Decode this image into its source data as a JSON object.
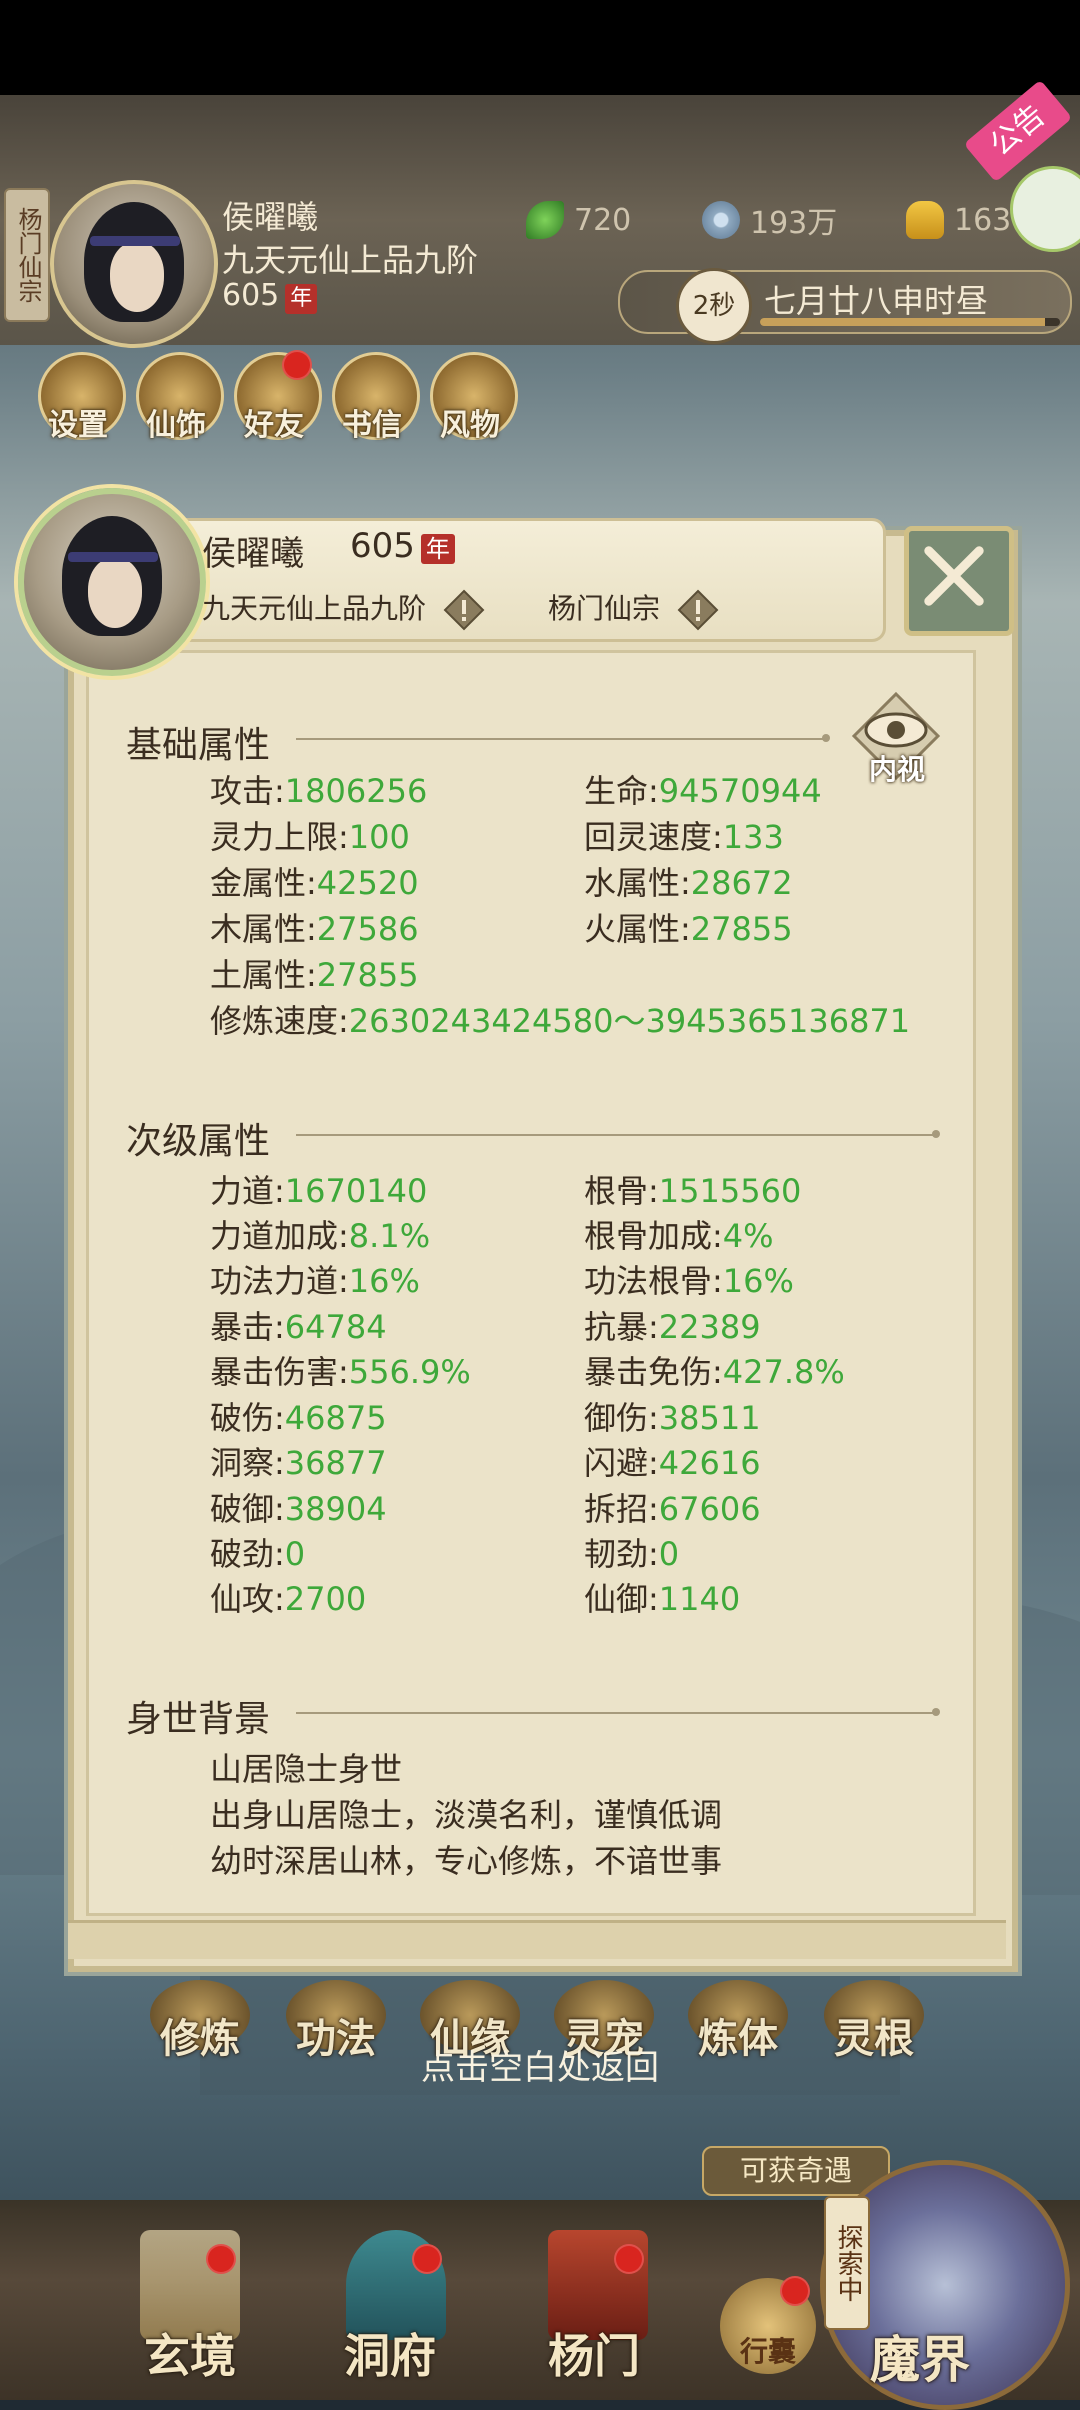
{
  "top_profile": {
    "sect_label": "杨门仙宗",
    "name": "侯曜曦",
    "rank": "九天元仙上品九阶",
    "age": "605",
    "age_unit": "年"
  },
  "currencies": [
    {
      "icon": "leaf-icon",
      "value": "720"
    },
    {
      "icon": "coin-icon",
      "value": "193万"
    },
    {
      "icon": "ingot-icon",
      "value": "163"
    }
  ],
  "notice": {
    "label": "公告"
  },
  "time_bar": {
    "seconds": "2秒",
    "date_text": "七月廿八申时昼",
    "progress": 0.95
  },
  "menu": [
    {
      "label": "设置",
      "icon": "settings-icon",
      "red_dot": false
    },
    {
      "label": "仙饰",
      "icon": "costume-icon",
      "red_dot": false
    },
    {
      "label": "好友",
      "icon": "friends-icon",
      "red_dot": true
    },
    {
      "label": "书信",
      "icon": "letter-icon",
      "red_dot": false
    },
    {
      "label": "风物",
      "icon": "scenery-icon",
      "red_dot": false
    }
  ],
  "panel": {
    "name": "侯曜曦",
    "age": "605",
    "age_unit": "年",
    "rank": "九天元仙上品九阶",
    "sect": "杨门仙宗",
    "inner_view_label": "内视",
    "basic_title": "基础属性",
    "basic_stats": [
      {
        "label": "攻击:",
        "value": "1806256"
      },
      {
        "label": "生命:",
        "value": "94570944"
      },
      {
        "label": "灵力上限:",
        "value": "100"
      },
      {
        "label": "回灵速度:",
        "value": "133"
      },
      {
        "label": "金属性:",
        "value": "42520"
      },
      {
        "label": "水属性:",
        "value": "28672"
      },
      {
        "label": "木属性:",
        "value": "27586"
      },
      {
        "label": "火属性:",
        "value": "27855"
      },
      {
        "label": "土属性:",
        "value": "27855"
      }
    ],
    "cultivation_speed": {
      "label": "修炼速度:",
      "value": "2630243424580～3945365136871"
    },
    "secondary_title": "次级属性",
    "secondary_stats": [
      {
        "label": "力道:",
        "value": "1670140"
      },
      {
        "label": "根骨:",
        "value": "1515560"
      },
      {
        "label": "力道加成:",
        "value": "8.1%"
      },
      {
        "label": "根骨加成:",
        "value": "4%"
      },
      {
        "label": "功法力道:",
        "value": "16%"
      },
      {
        "label": "功法根骨:",
        "value": "16%"
      },
      {
        "label": "暴击:",
        "value": "64784"
      },
      {
        "label": "抗暴:",
        "value": "22389"
      },
      {
        "label": "暴击伤害:",
        "value": "556.9%"
      },
      {
        "label": "暴击免伤:",
        "value": "427.8%"
      },
      {
        "label": "破伤:",
        "value": "46875"
      },
      {
        "label": "御伤:",
        "value": "38511"
      },
      {
        "label": "洞察:",
        "value": "36877"
      },
      {
        "label": "闪避:",
        "value": "42616"
      },
      {
        "label": "破御:",
        "value": "38904"
      },
      {
        "label": "拆招:",
        "value": "67606"
      },
      {
        "label": "破劲:",
        "value": "0"
      },
      {
        "label": "韧劲:",
        "value": "0"
      },
      {
        "label": "仙攻:",
        "value": "2700"
      },
      {
        "label": "仙御:",
        "value": "1140"
      }
    ],
    "background_title": "身世背景",
    "background_lines": [
      "山居隐士身世",
      "出身山居隐士，淡漠名利，谨慎低调",
      "幼时深居山林，专心修炼，不谙世事"
    ]
  },
  "bottom_menu": [
    "修炼",
    "功法",
    "仙缘",
    "灵宠",
    "炼体",
    "灵根"
  ],
  "back_hint": "点击空白处返回",
  "chance_button": "可获奇遇",
  "nav": [
    {
      "label": "玄境",
      "red_dot": true
    },
    {
      "label": "洞府",
      "red_dot": true
    },
    {
      "label": "杨门",
      "red_dot": true
    }
  ],
  "bag_label": "行囊",
  "exploring_label": "探索中",
  "mojie_label": "魔界",
  "colors": {
    "value_green": "#3ea83a",
    "text_dark": "#3a2d20",
    "badge_red": "#b5302a",
    "notice_pink": "#e84b8a"
  }
}
